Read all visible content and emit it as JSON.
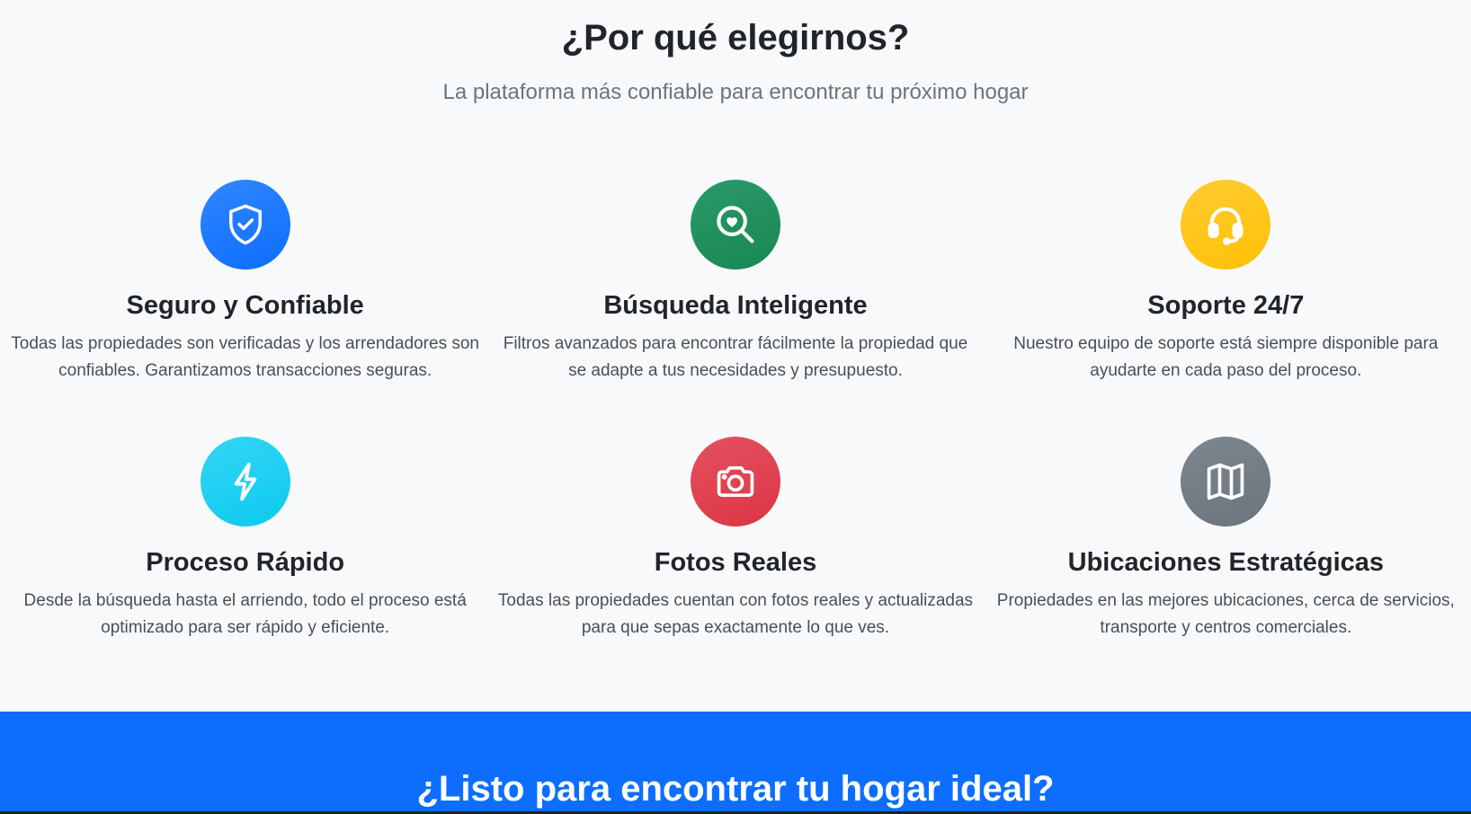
{
  "section": {
    "title": "¿Por qué elegirnos?",
    "subtitle": "La plataforma más confiable para encontrar tu próximo hogar"
  },
  "features": [
    {
      "title": "Seguro y Confiable",
      "text": "Todas las propiedades son verificadas y los arrendadores son confiables. Garantizamos transacciones seguras.",
      "icon": "shield-check-icon",
      "color": "#0d6efd"
    },
    {
      "title": "Búsqueda Inteligente",
      "text": "Filtros avanzados para encontrar fácilmente la propiedad que se adapte a tus necesidades y presupuesto.",
      "icon": "search-heart-icon",
      "color": "#198754"
    },
    {
      "title": "Soporte 24/7",
      "text": "Nuestro equipo de soporte está siempre disponible para ayudarte en cada paso del proceso.",
      "icon": "headset-icon",
      "color": "#ffc107"
    },
    {
      "title": "Proceso Rápido",
      "text": "Desde la búsqueda hasta el arriendo, todo el proceso está optimizado para ser rápido y eficiente.",
      "icon": "lightning-icon",
      "color": "#0dcaf0"
    },
    {
      "title": "Fotos Reales",
      "text": "Todas las propiedades cuentan con fotos reales y actualizadas para que sepas exactamente lo que ves.",
      "icon": "camera-icon",
      "color": "#dc3545"
    },
    {
      "title": "Ubicaciones Estratégicas",
      "text": "Propiedades en las mejores ubicaciones, cerca de servicios, transporte y centros comerciales.",
      "icon": "map-icon",
      "color": "#6c757d"
    }
  ],
  "cta": {
    "title": "¿Listo para encontrar tu hogar ideal?"
  }
}
